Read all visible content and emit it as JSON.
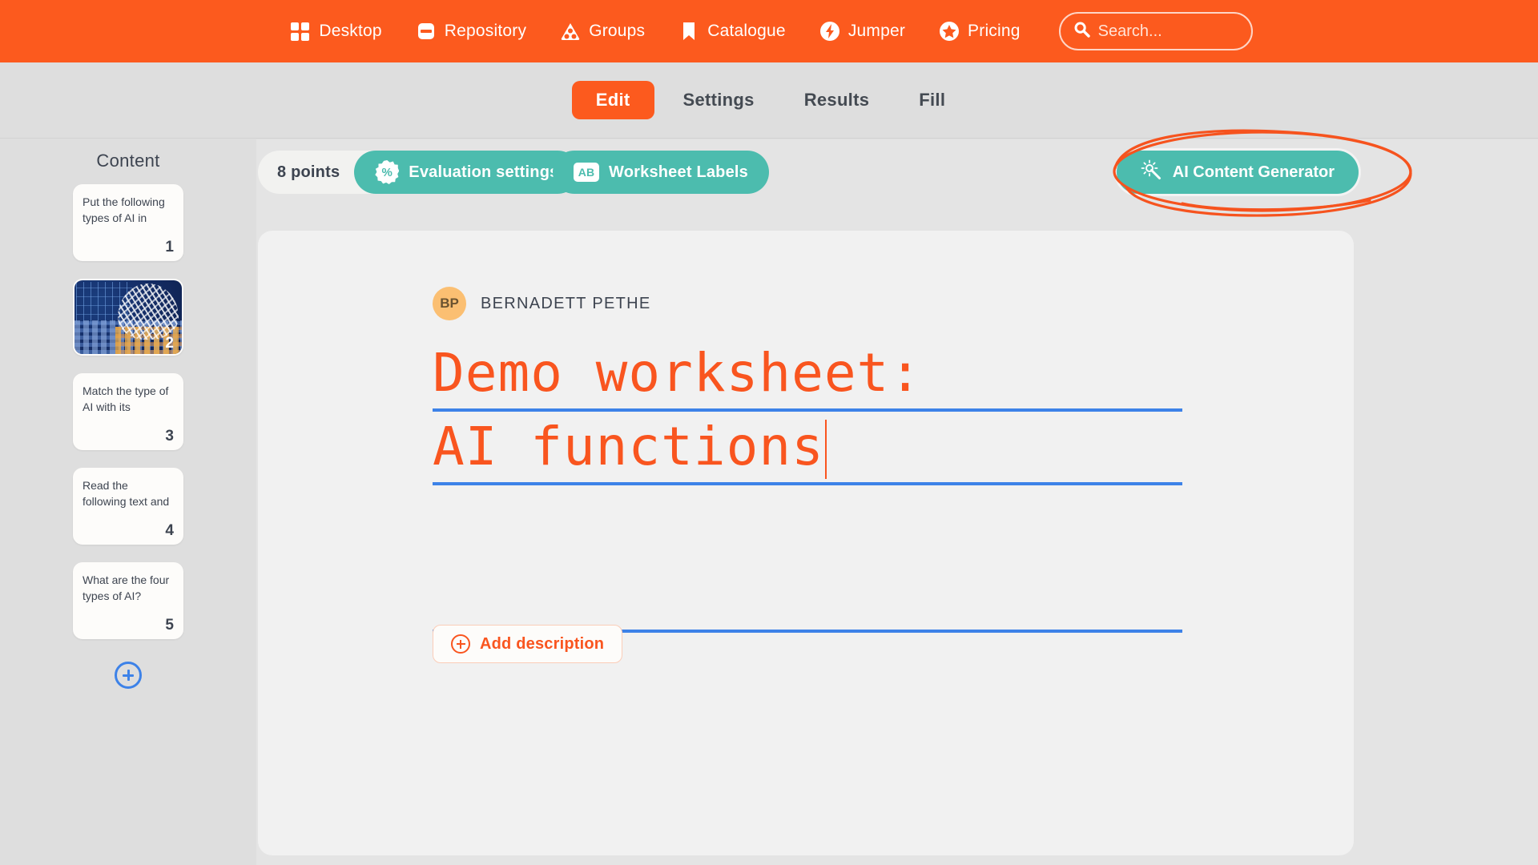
{
  "topnav": {
    "background": "#fc5a1e",
    "items": [
      {
        "label": "Desktop",
        "icon": "grid-icon"
      },
      {
        "label": "Repository",
        "icon": "repository-icon"
      },
      {
        "label": "Groups",
        "icon": "groups-icon"
      },
      {
        "label": "Catalogue",
        "icon": "bookmark-icon"
      },
      {
        "label": "Jumper",
        "icon": "lightning-circle-icon"
      },
      {
        "label": "Pricing",
        "icon": "star-circle-icon"
      }
    ],
    "search": {
      "placeholder": "Search...",
      "value": "",
      "icon": "search-icon"
    }
  },
  "tabs": [
    {
      "label": "Edit",
      "active": true
    },
    {
      "label": "Settings",
      "active": false
    },
    {
      "label": "Results",
      "active": false
    },
    {
      "label": "Fill",
      "active": false
    }
  ],
  "sidebar": {
    "title": "Content",
    "add_label": "+",
    "slides": [
      {
        "number": "1",
        "text": "Put the following types of AI in",
        "type": "text"
      },
      {
        "number": "2",
        "text": "",
        "type": "image"
      },
      {
        "number": "3",
        "text": "Match the type of AI with its",
        "type": "text"
      },
      {
        "number": "4",
        "text": "Read the following text and",
        "type": "text"
      },
      {
        "number": "5",
        "text": "What are the four types of AI?",
        "type": "text"
      }
    ]
  },
  "toolbar": {
    "points": "8 points",
    "evaluation_settings": "Evaluation settings",
    "evaluation_icon_text": "%",
    "worksheet_labels": "Worksheet Labels",
    "worksheet_icon_text": "AB",
    "ai_generator": "AI Content Generator",
    "ai_icon": "magic-sparkle-icon",
    "teal": "#4cbcae",
    "annotation": "hand-drawn-orange-ellipse"
  },
  "worksheet": {
    "author_initials": "BP",
    "author_name": "BERNADETT PETHE",
    "title_line1": "Demo worksheet:",
    "title_line2": "AI functions",
    "title_line3": "",
    "add_description": "Add description",
    "title_color": "#f9551f",
    "rule_color": "#3d82e8"
  }
}
